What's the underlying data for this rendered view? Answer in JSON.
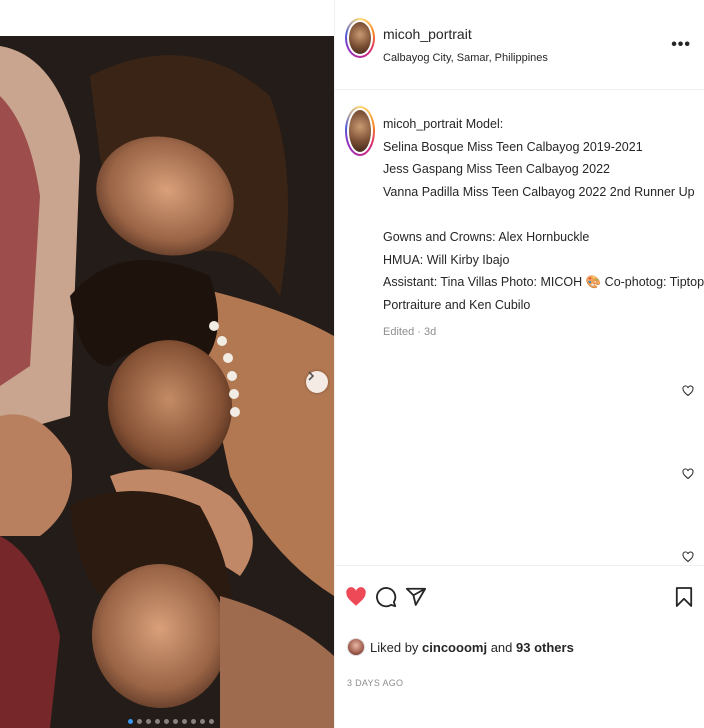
{
  "post": {
    "username": "micoh_portrait",
    "location": "Calbayog City, Samar, Philippines",
    "more_label": "•••"
  },
  "caption": {
    "username": "micoh_portrait",
    "lines": [
      "Model:",
      "Selina Bosque Miss Teen Calbayog 2019-2021",
      "Jess Gaspang Miss Teen Calbayog 2022",
      "Vanna Padilla Miss Teen Calbayog 2022 2nd Runner Up",
      "",
      "Gowns and Crowns: Alex Hornbuckle",
      "HMUA: Will Kirby Ibajo",
      "Assistant: Tina Villas Photo: MICOH 🎨 Co-photog: Tiptop",
      "Portraiture and Ken Cubilo"
    ],
    "edited": "Edited · 3d"
  },
  "actions": {
    "liked": true,
    "liked_by_user": "cincooomj",
    "liked_by_prefix": "Liked by",
    "liked_by_and": "and",
    "others": "93 others",
    "time_ago": "3 DAYS AGO"
  },
  "carousel": {
    "count": 10,
    "active_index": 0
  },
  "colors": {
    "heart_red": "#ed4956",
    "muted": "#8e8e8e",
    "dot_active": "#3897f0"
  },
  "icons": [
    "next-chevron-icon",
    "more-options-icon",
    "heart-filled-icon",
    "comment-icon",
    "share-icon",
    "bookmark-icon",
    "heart-outline-icon"
  ]
}
